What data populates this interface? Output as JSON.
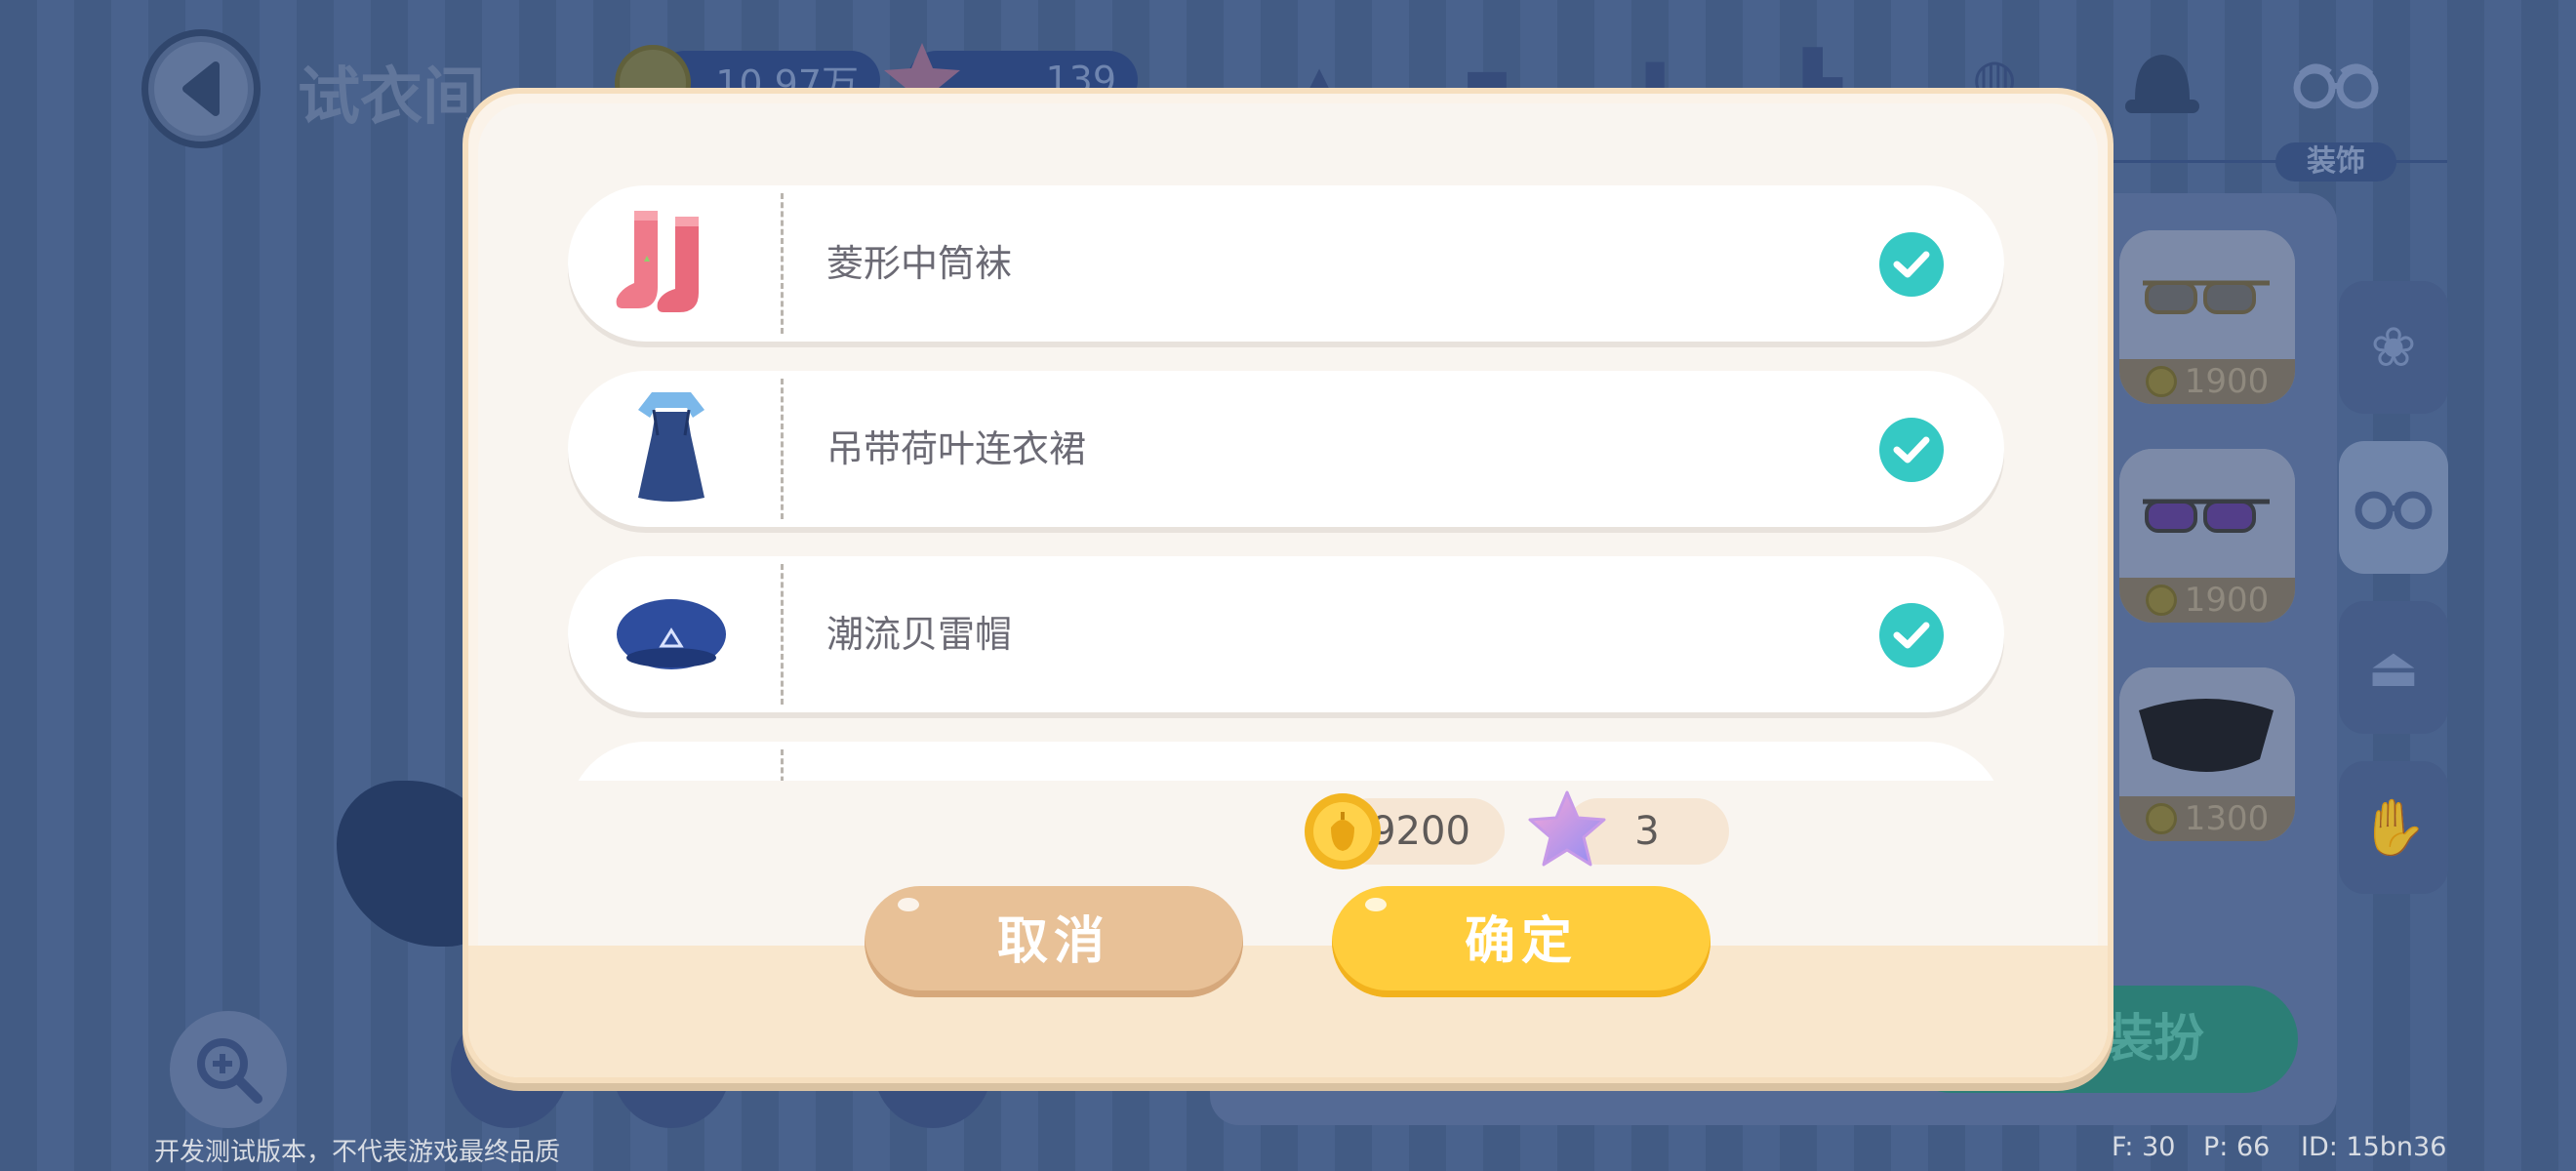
{
  "background": {
    "title": "试衣间",
    "coins": "10.97万",
    "stars": "139",
    "category_label": "装饰",
    "items": [
      {
        "price": "1900",
        "icon": "gold-aviator-glasses"
      },
      {
        "price": "1900",
        "icon": "purple-aviator-glasses"
      },
      {
        "price": "1300",
        "icon": "black-face-mask"
      }
    ],
    "dress_button": "装扮",
    "footer_notice": "开发测试版本，不代表游戏最终品质",
    "debug": {
      "f": "F: 30",
      "p": "P: 66",
      "id": "ID: 15bn36"
    }
  },
  "dialog": {
    "items": [
      {
        "name": "菱形中筒袜",
        "icon": "pink-socks-icon",
        "checked": true
      },
      {
        "name": "吊带荷叶连衣裙",
        "icon": "blue-dress-icon",
        "checked": true
      },
      {
        "name": "潮流贝雷帽",
        "icon": "blue-beret-icon",
        "checked": true
      }
    ],
    "total_coins": "9200",
    "total_stars": "3",
    "cancel_label": "取消",
    "confirm_label": "确定"
  },
  "colors": {
    "check": "#35c9c4",
    "confirm": "#ffcd3c",
    "cancel": "#e8c197",
    "panel": "#fbf3e9"
  }
}
